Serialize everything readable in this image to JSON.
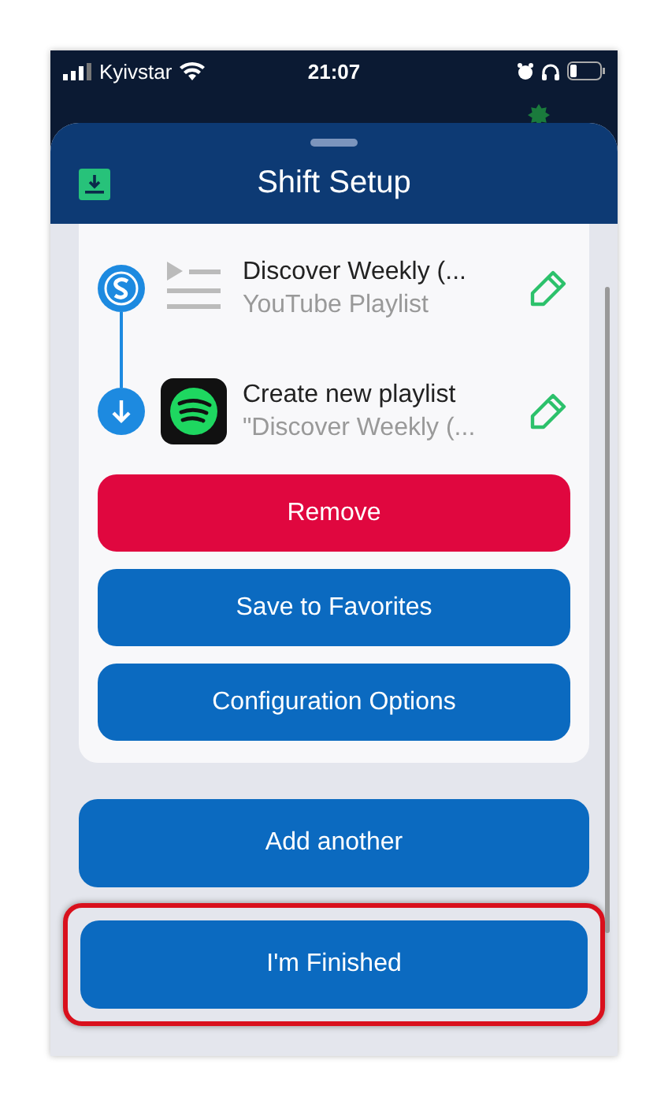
{
  "status_bar": {
    "carrier": "Kyivstar",
    "time": "21:07"
  },
  "sheet": {
    "title": "Shift Setup"
  },
  "shift": {
    "source": {
      "title": "Discover Weekly (...",
      "subtitle": "YouTube Playlist"
    },
    "destination": {
      "title": "Create new playlist",
      "subtitle": "\"Discover Weekly (..."
    }
  },
  "card_buttons": [
    {
      "label": "Remove",
      "kind": "danger"
    },
    {
      "label": "Save to Favorites",
      "kind": "primary"
    },
    {
      "label": "Configuration Options",
      "kind": "primary"
    }
  ],
  "buttons": [
    {
      "label": "Add another",
      "highlighted": false
    },
    {
      "label": "I'm Finished",
      "highlighted": true
    }
  ]
}
